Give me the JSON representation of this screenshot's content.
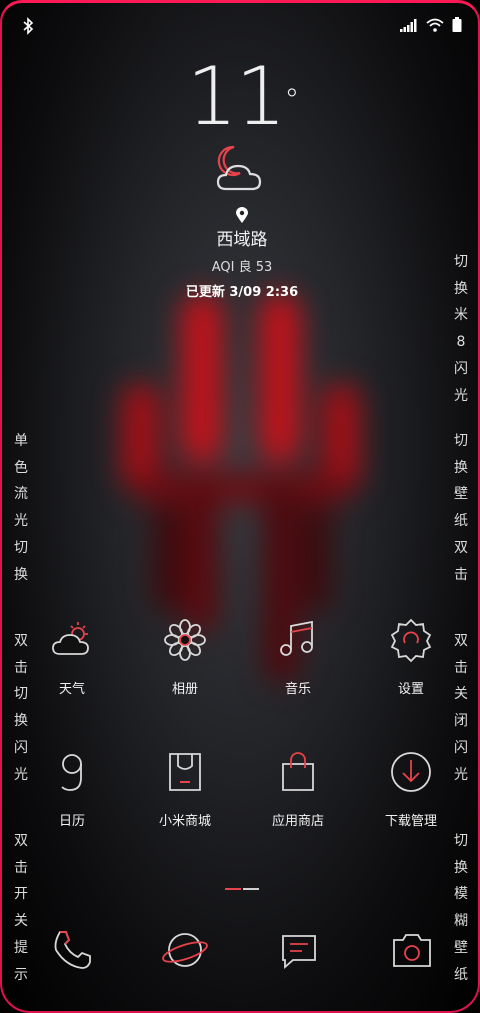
{
  "status_bar": {
    "bluetooth_icon": "bluetooth-icon",
    "signal_icon": "signal-icon",
    "wifi_icon": "wifi-icon",
    "battery_icon": "battery-icon"
  },
  "weather": {
    "temperature": "11",
    "degree": "°",
    "condition_icon": "night-cloudy-icon",
    "location": "西域路",
    "aqi": "AQI 良 53",
    "updated": "已更新 3/09 2:36"
  },
  "gestures": {
    "right_1": "切换米8闪光",
    "right_2": "切换壁纸双击",
    "right_3": "双击关闭闪光",
    "right_4": "切换模糊壁纸",
    "left_1": "单色流光切换",
    "left_2": "双击切换闪光",
    "left_3": "双击开关提示"
  },
  "apps_row1": [
    {
      "label": "天气",
      "icon": "weather-icon"
    },
    {
      "label": "相册",
      "icon": "gallery-icon"
    },
    {
      "label": "音乐",
      "icon": "music-icon"
    },
    {
      "label": "设置",
      "icon": "settings-icon"
    }
  ],
  "apps_row2": [
    {
      "label": "日历",
      "icon": "calendar-icon"
    },
    {
      "label": "小米商城",
      "icon": "mi-store-icon"
    },
    {
      "label": "应用商店",
      "icon": "app-store-icon"
    },
    {
      "label": "下载管理",
      "icon": "download-icon"
    }
  ],
  "page_indicator": {
    "pages": 2,
    "current": 1
  },
  "dock": [
    "phone-icon",
    "browser-icon",
    "messages-icon",
    "camera-icon"
  ],
  "colors": {
    "accent": "#e8424a",
    "frame": "#e0124f",
    "icon_stroke": "#d8d8d8"
  }
}
